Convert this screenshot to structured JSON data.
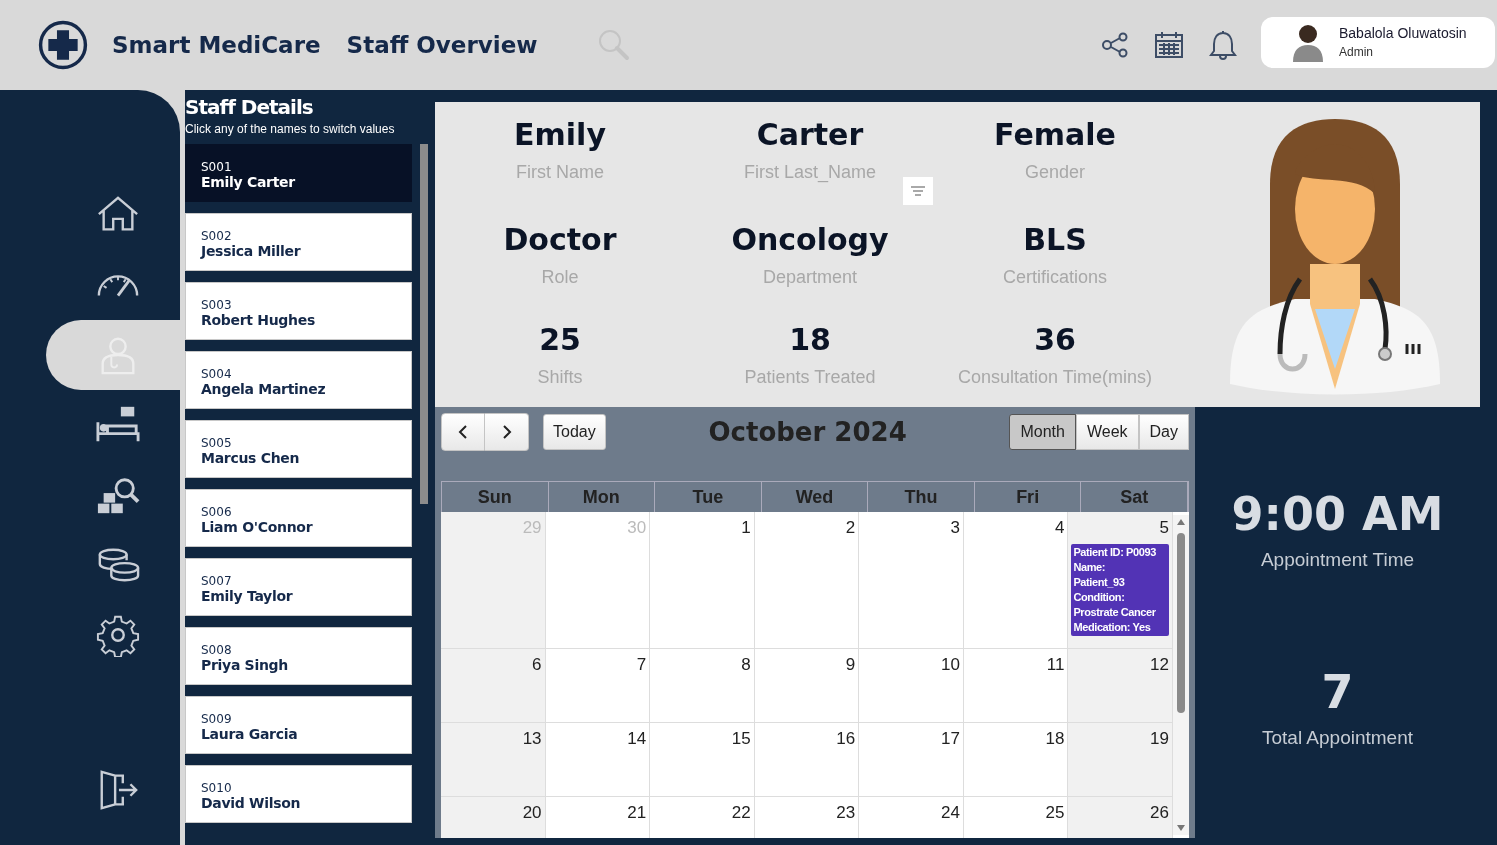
{
  "header": {
    "app_name": "Smart MediCare",
    "page_title": "Staff Overview",
    "user": {
      "name": "Babalola Oluwatosin",
      "role": "Admin"
    }
  },
  "sidebar": {
    "items": [
      {
        "kind": "home",
        "selected": false
      },
      {
        "kind": "gauge",
        "selected": false
      },
      {
        "kind": "doctor",
        "selected": true
      },
      {
        "kind": "bed",
        "selected": false
      },
      {
        "kind": "inventory",
        "selected": false
      },
      {
        "kind": "coins",
        "selected": false
      },
      {
        "kind": "settings",
        "selected": false
      },
      {
        "kind": "logout",
        "selected": false
      }
    ]
  },
  "staff_panel": {
    "title": "Staff Details",
    "subtitle": "Click any of the names to switch values",
    "staff": [
      {
        "id": "S001",
        "name": "Emily Carter",
        "selected": true
      },
      {
        "id": "S002",
        "name": "Jessica Miller",
        "selected": false
      },
      {
        "id": "S003",
        "name": "Robert Hughes",
        "selected": false
      },
      {
        "id": "S004",
        "name": "Angela Martinez",
        "selected": false
      },
      {
        "id": "S005",
        "name": "Marcus Chen",
        "selected": false
      },
      {
        "id": "S006",
        "name": "Liam O'Connor",
        "selected": false
      },
      {
        "id": "S007",
        "name": "Emily Taylor",
        "selected": false
      },
      {
        "id": "S008",
        "name": "Priya Singh",
        "selected": false
      },
      {
        "id": "S009",
        "name": "Laura Garcia",
        "selected": false
      },
      {
        "id": "S010",
        "name": "David Wilson",
        "selected": false
      }
    ]
  },
  "profile": {
    "fields": [
      {
        "value": "Emily",
        "label": "First Name"
      },
      {
        "value": "Carter",
        "label": "First Last_Name"
      },
      {
        "value": "Female",
        "label": "Gender"
      },
      {
        "value": "Doctor",
        "label": "Role"
      },
      {
        "value": "Oncology",
        "label": "Department"
      },
      {
        "value": "BLS",
        "label": "Certifications"
      },
      {
        "value": "25",
        "label": "Shifts"
      },
      {
        "value": "18",
        "label": "Patients Treated"
      },
      {
        "value": "36",
        "label": "Consultation Time(mins)"
      }
    ]
  },
  "calendar": {
    "today_label": "Today",
    "title": "October 2024",
    "views": [
      {
        "label": "Month",
        "selected": true
      },
      {
        "label": "Week",
        "selected": false
      },
      {
        "label": "Day",
        "selected": false
      }
    ],
    "weekdays": [
      "Sun",
      "Mon",
      "Tue",
      "Wed",
      "Thu",
      "Fri",
      "Sat"
    ],
    "weeks": [
      [
        {
          "day": "29",
          "other_month": true
        },
        {
          "day": "30",
          "other_month": true
        },
        {
          "day": "1",
          "other_month": false
        },
        {
          "day": "2",
          "other_month": false
        },
        {
          "day": "3",
          "other_month": false
        },
        {
          "day": "4",
          "other_month": false
        },
        {
          "day": "5",
          "other_month": false,
          "events": [
            {
              "text": "Patient ID: P0093\nName:\nPatient_93\nCondition:\nProstrate Cancer\nMedication: Yes",
              "color": "#5233b5"
            }
          ]
        }
      ],
      [
        {
          "day": "6",
          "other_month": false
        },
        {
          "day": "7",
          "other_month": false
        },
        {
          "day": "8",
          "other_month": false
        },
        {
          "day": "9",
          "other_month": false
        },
        {
          "day": "10",
          "other_month": false
        },
        {
          "day": "11",
          "other_month": false
        },
        {
          "day": "12",
          "other_month": false
        }
      ],
      [
        {
          "day": "13",
          "other_month": false
        },
        {
          "day": "14",
          "other_month": false
        },
        {
          "day": "15",
          "other_month": false
        },
        {
          "day": "16",
          "other_month": false
        },
        {
          "day": "17",
          "other_month": false
        },
        {
          "day": "18",
          "other_month": false
        },
        {
          "day": "19",
          "other_month": false
        }
      ],
      [
        {
          "day": "20",
          "other_month": false
        },
        {
          "day": "21",
          "other_month": false
        },
        {
          "day": "22",
          "other_month": false
        },
        {
          "day": "23",
          "other_month": false
        },
        {
          "day": "24",
          "other_month": false
        },
        {
          "day": "25",
          "other_month": false
        },
        {
          "day": "26",
          "other_month": false
        }
      ]
    ]
  },
  "stats": [
    {
      "value": "9:00 AM",
      "label": "Appointment Time"
    },
    {
      "value": "7",
      "label": "Total Appointment"
    }
  ]
}
